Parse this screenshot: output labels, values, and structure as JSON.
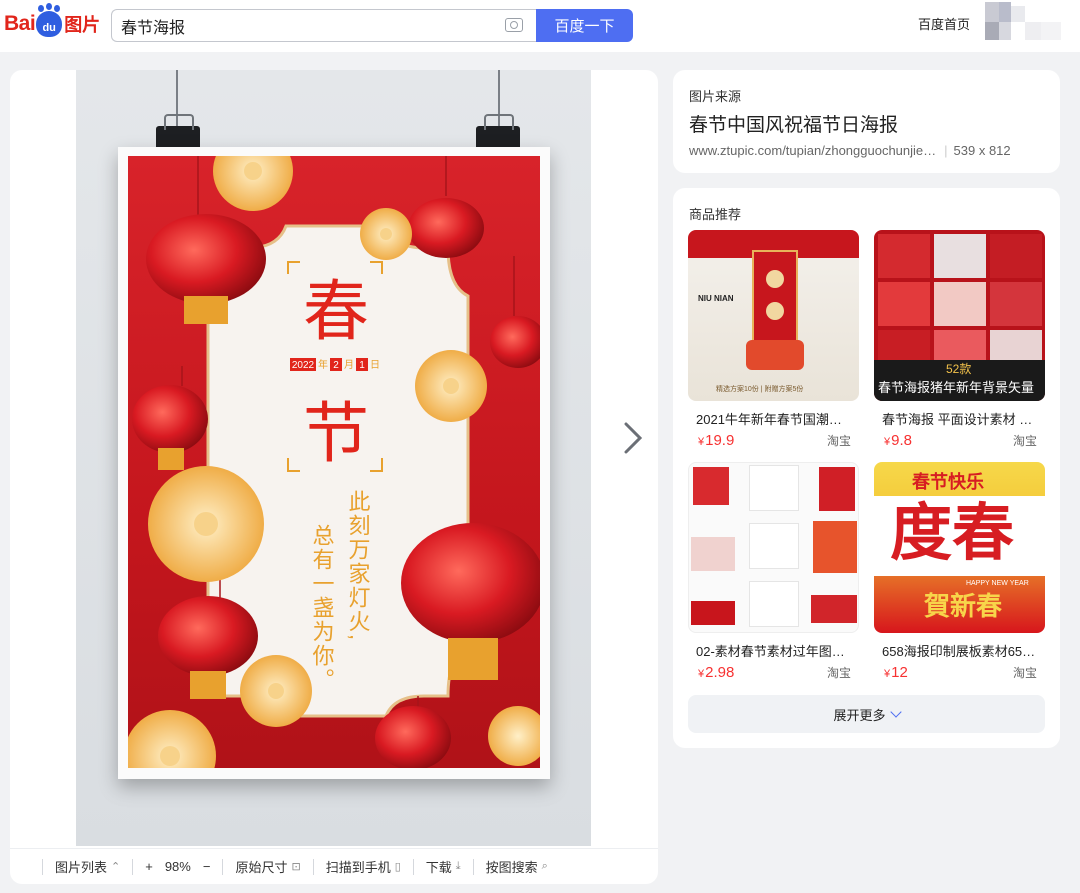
{
  "header": {
    "logo_text": "Bai du 图片",
    "logo_bai": "Bai",
    "logo_du": "du",
    "logo_img": "图片",
    "search_value": "春节海报",
    "search_button": "百度一下",
    "home_link": "百度首页"
  },
  "viewer": {
    "poster": {
      "title_char_1": "春",
      "title_char_2": "节",
      "date_year": "2022",
      "date_year_unit": "年",
      "date_month": "2",
      "date_month_unit": "月",
      "date_day": "1",
      "date_day_unit": "日",
      "verse_line_1": "此刻万家灯火,",
      "verse_line_2": "总有一盏为你。"
    },
    "toolbar": {
      "image_list": "图片列表",
      "zoom_in": "+",
      "zoom_value": "98%",
      "zoom_out": "−",
      "original_size": "原始尺寸",
      "scan_to_phone": "扫描到手机",
      "download": "下载",
      "search_by_image": "按图搜索"
    }
  },
  "source": {
    "label": "图片来源",
    "title": "春节中国风祝福节日海报",
    "url": "www.ztupic.com/tupian/zhongguochunjie…",
    "dimensions": "539 x 812"
  },
  "recommendations": {
    "title": "商品推荐",
    "products": [
      {
        "name": "2021牛年新年春节国潮民…",
        "currency": "¥",
        "price": "19.9",
        "shop": "淘宝",
        "thumb_text": "NIU NIAN",
        "thumb_caption": "精选方案10份 | 附赠方案5份"
      },
      {
        "name": "春节海报 平面设计素材 …",
        "currency": "¥",
        "price": "9.8",
        "shop": "淘宝",
        "thumb_badge": "52款",
        "thumb_caption": "春节海报猪年新年背景矢量"
      },
      {
        "name": "02-素材春节素材过年图…",
        "currency": "¥",
        "price": "2.98",
        "shop": "淘宝"
      },
      {
        "name": "658海报印制展板素材65…",
        "currency": "¥",
        "price": "12",
        "shop": "淘宝",
        "thumb_top": "春节快乐",
        "thumb_big": "度春",
        "thumb_greeting": "賀新春",
        "thumb_happy": "HAPPY NEW YEAR"
      }
    ],
    "more_button": "展开更多"
  },
  "colors": {
    "brand_blue": "#4e6ef2",
    "baidu_red": "#e1251b",
    "price_red": "#f73131",
    "poster_red": "#d8232a",
    "poster_gold": "#f2b54a"
  }
}
